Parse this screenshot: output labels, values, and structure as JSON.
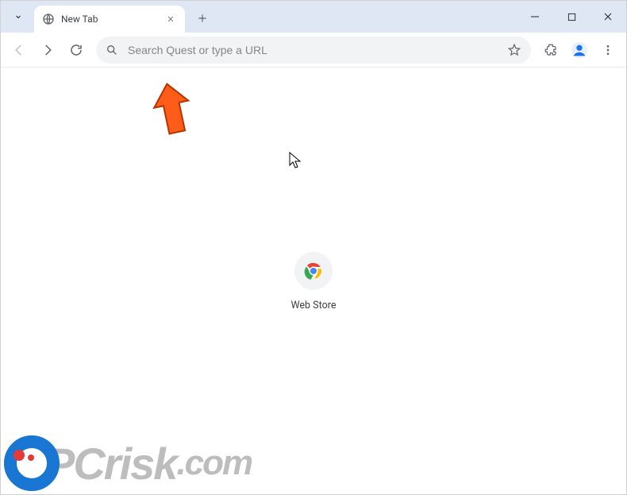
{
  "window": {
    "tab_title": "New Tab"
  },
  "omnibox": {
    "placeholder": "Search Quest or type a URL",
    "value": ""
  },
  "shortcuts": [
    {
      "label": "Web Store"
    }
  ],
  "watermark": {
    "text_pc": "PC",
    "text_risk": "risk",
    "text_dotcom": ".com"
  }
}
